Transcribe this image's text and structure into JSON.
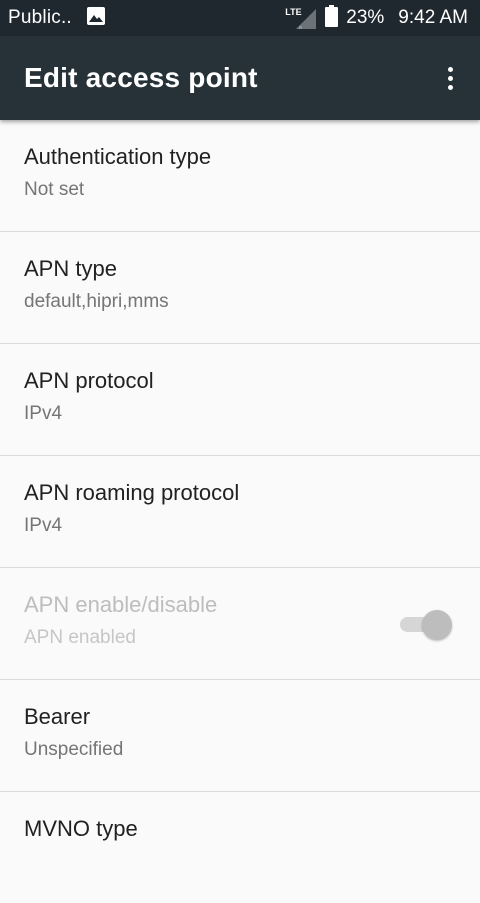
{
  "status_bar": {
    "carrier": "Public..",
    "network_type": "LTE",
    "battery": "23%",
    "time": "9:42 AM"
  },
  "toolbar": {
    "title": "Edit access point"
  },
  "items": [
    {
      "title": "Authentication type",
      "summary": "Not set"
    },
    {
      "title": "APN type",
      "summary": "default,hipri,mms"
    },
    {
      "title": "APN protocol",
      "summary": "IPv4"
    },
    {
      "title": "APN roaming protocol",
      "summary": "IPv4"
    },
    {
      "title": "APN enable/disable",
      "summary": "APN enabled"
    },
    {
      "title": "Bearer",
      "summary": "Unspecified"
    },
    {
      "title": "MVNO type"
    }
  ],
  "apn_switch": {
    "checked": true,
    "enabled": false
  },
  "colors": {
    "status_bar": "#1f282e",
    "toolbar": "#263238",
    "background": "#fafafa"
  }
}
